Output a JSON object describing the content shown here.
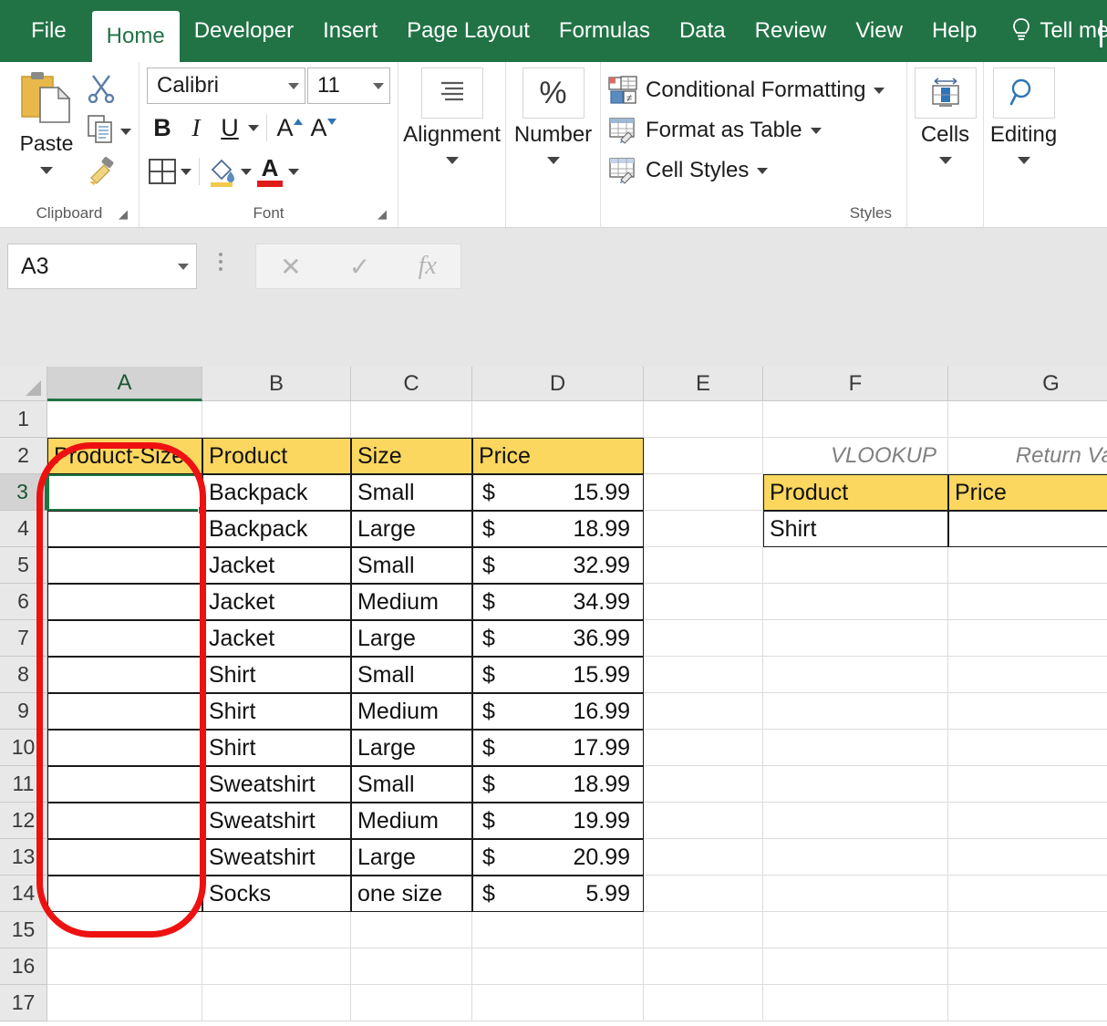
{
  "app": {
    "tabs": [
      {
        "label": "File",
        "active": false,
        "name": "tab-file"
      },
      {
        "label": "Home",
        "active": true,
        "name": "tab-home"
      },
      {
        "label": "Developer",
        "active": false,
        "name": "tab-developer"
      },
      {
        "label": "Insert",
        "active": false,
        "name": "tab-insert"
      },
      {
        "label": "Page Layout",
        "active": false,
        "name": "tab-page-layout"
      },
      {
        "label": "Formulas",
        "active": false,
        "name": "tab-formulas"
      },
      {
        "label": "Data",
        "active": false,
        "name": "tab-data"
      },
      {
        "label": "Review",
        "active": false,
        "name": "tab-review"
      },
      {
        "label": "View",
        "active": false,
        "name": "tab-view"
      },
      {
        "label": "Help",
        "active": false,
        "name": "tab-help"
      }
    ],
    "tell_me": "Tell me"
  },
  "ribbon": {
    "clipboard": {
      "group_label": "Clipboard",
      "paste_label": "Paste",
      "icons": [
        "paste-icon",
        "cut-scissors-icon",
        "copy-icon",
        "format-painter-icon"
      ]
    },
    "font": {
      "group_label": "Font",
      "font_name": "Calibri",
      "font_size": "11",
      "bold": "B",
      "italic": "I",
      "underline": "U",
      "grow_font": "A",
      "shrink_font": "A",
      "icons": [
        "borders-icon",
        "fill-color-icon",
        "font-color-icon"
      ]
    },
    "alignment": {
      "group_label": "Alignment",
      "icon": "align-lines-icon"
    },
    "number": {
      "group_label": "Number",
      "icon": "percent-icon",
      "symbol": "%"
    },
    "styles": {
      "group_label": "Styles",
      "items": [
        {
          "label": "Conditional Formatting",
          "icon": "conditional-formatting-icon",
          "caret": true
        },
        {
          "label": "Format as Table",
          "icon": "format-as-table-icon",
          "caret": true
        },
        {
          "label": "Cell Styles",
          "icon": "cell-styles-icon",
          "caret": true
        }
      ]
    },
    "cells": {
      "group_label": "Cells",
      "icon": "cells-insert-icon"
    },
    "editing": {
      "group_label": "Editing",
      "icon": "find-magnifier-icon"
    }
  },
  "formula_bar": {
    "name_box_value": "A3",
    "cancel_icon": "✕",
    "enter_icon": "✓",
    "fx_label": "fx",
    "formula_value": ""
  },
  "grid": {
    "column_headers": [
      "A",
      "B",
      "C",
      "D",
      "E",
      "F",
      "G"
    ],
    "selected_column": "A",
    "row_headers": [
      "1",
      "2",
      "3",
      "4",
      "5",
      "6",
      "7",
      "8",
      "9",
      "10",
      "11",
      "12",
      "13",
      "14",
      "15",
      "16",
      "17"
    ],
    "selected_row": "3",
    "selected_cell": "A3",
    "table_headers": {
      "a2": "Product-Size",
      "b2": "Product",
      "c2": "Size",
      "d2": "Price"
    },
    "rows": [
      {
        "row": "3",
        "product": "Backpack",
        "size": "Small",
        "currency": "$",
        "price": "15.99"
      },
      {
        "row": "4",
        "product": "Backpack",
        "size": "Large",
        "currency": "$",
        "price": "18.99"
      },
      {
        "row": "5",
        "product": "Jacket",
        "size": "Small",
        "currency": "$",
        "price": "32.99"
      },
      {
        "row": "6",
        "product": "Jacket",
        "size": "Medium",
        "currency": "$",
        "price": "34.99"
      },
      {
        "row": "7",
        "product": "Jacket",
        "size": "Large",
        "currency": "$",
        "price": "36.99"
      },
      {
        "row": "8",
        "product": "Shirt",
        "size": "Small",
        "currency": "$",
        "price": "15.99"
      },
      {
        "row": "9",
        "product": "Shirt",
        "size": "Medium",
        "currency": "$",
        "price": "16.99"
      },
      {
        "row": "10",
        "product": "Shirt",
        "size": "Large",
        "currency": "$",
        "price": "17.99"
      },
      {
        "row": "11",
        "product": "Sweatshirt",
        "size": "Small",
        "currency": "$",
        "price": "18.99"
      },
      {
        "row": "12",
        "product": "Sweatshirt",
        "size": "Medium",
        "currency": "$",
        "price": "19.99"
      },
      {
        "row": "13",
        "product": "Sweatshirt",
        "size": "Large",
        "currency": "$",
        "price": "20.99"
      },
      {
        "row": "14",
        "product": "Socks",
        "size": "one size",
        "currency": "$",
        "price": "5.99"
      }
    ],
    "lookup": {
      "f2_label": "VLOOKUP",
      "g2_label": "Return Value",
      "f3_header": "Product",
      "g3_header": "Price",
      "f4_value": "Shirt",
      "g4_value": ""
    }
  },
  "annotation": {
    "shape": "red-rounded-rectangle",
    "color": "#ee1111",
    "target": "column-A-rows-2-to-14"
  },
  "colors": {
    "ribbon_green": "#217346",
    "header_yellow": "#FCD75F",
    "selection_green": "#1a7a43",
    "annotation_red": "#ee1111"
  }
}
